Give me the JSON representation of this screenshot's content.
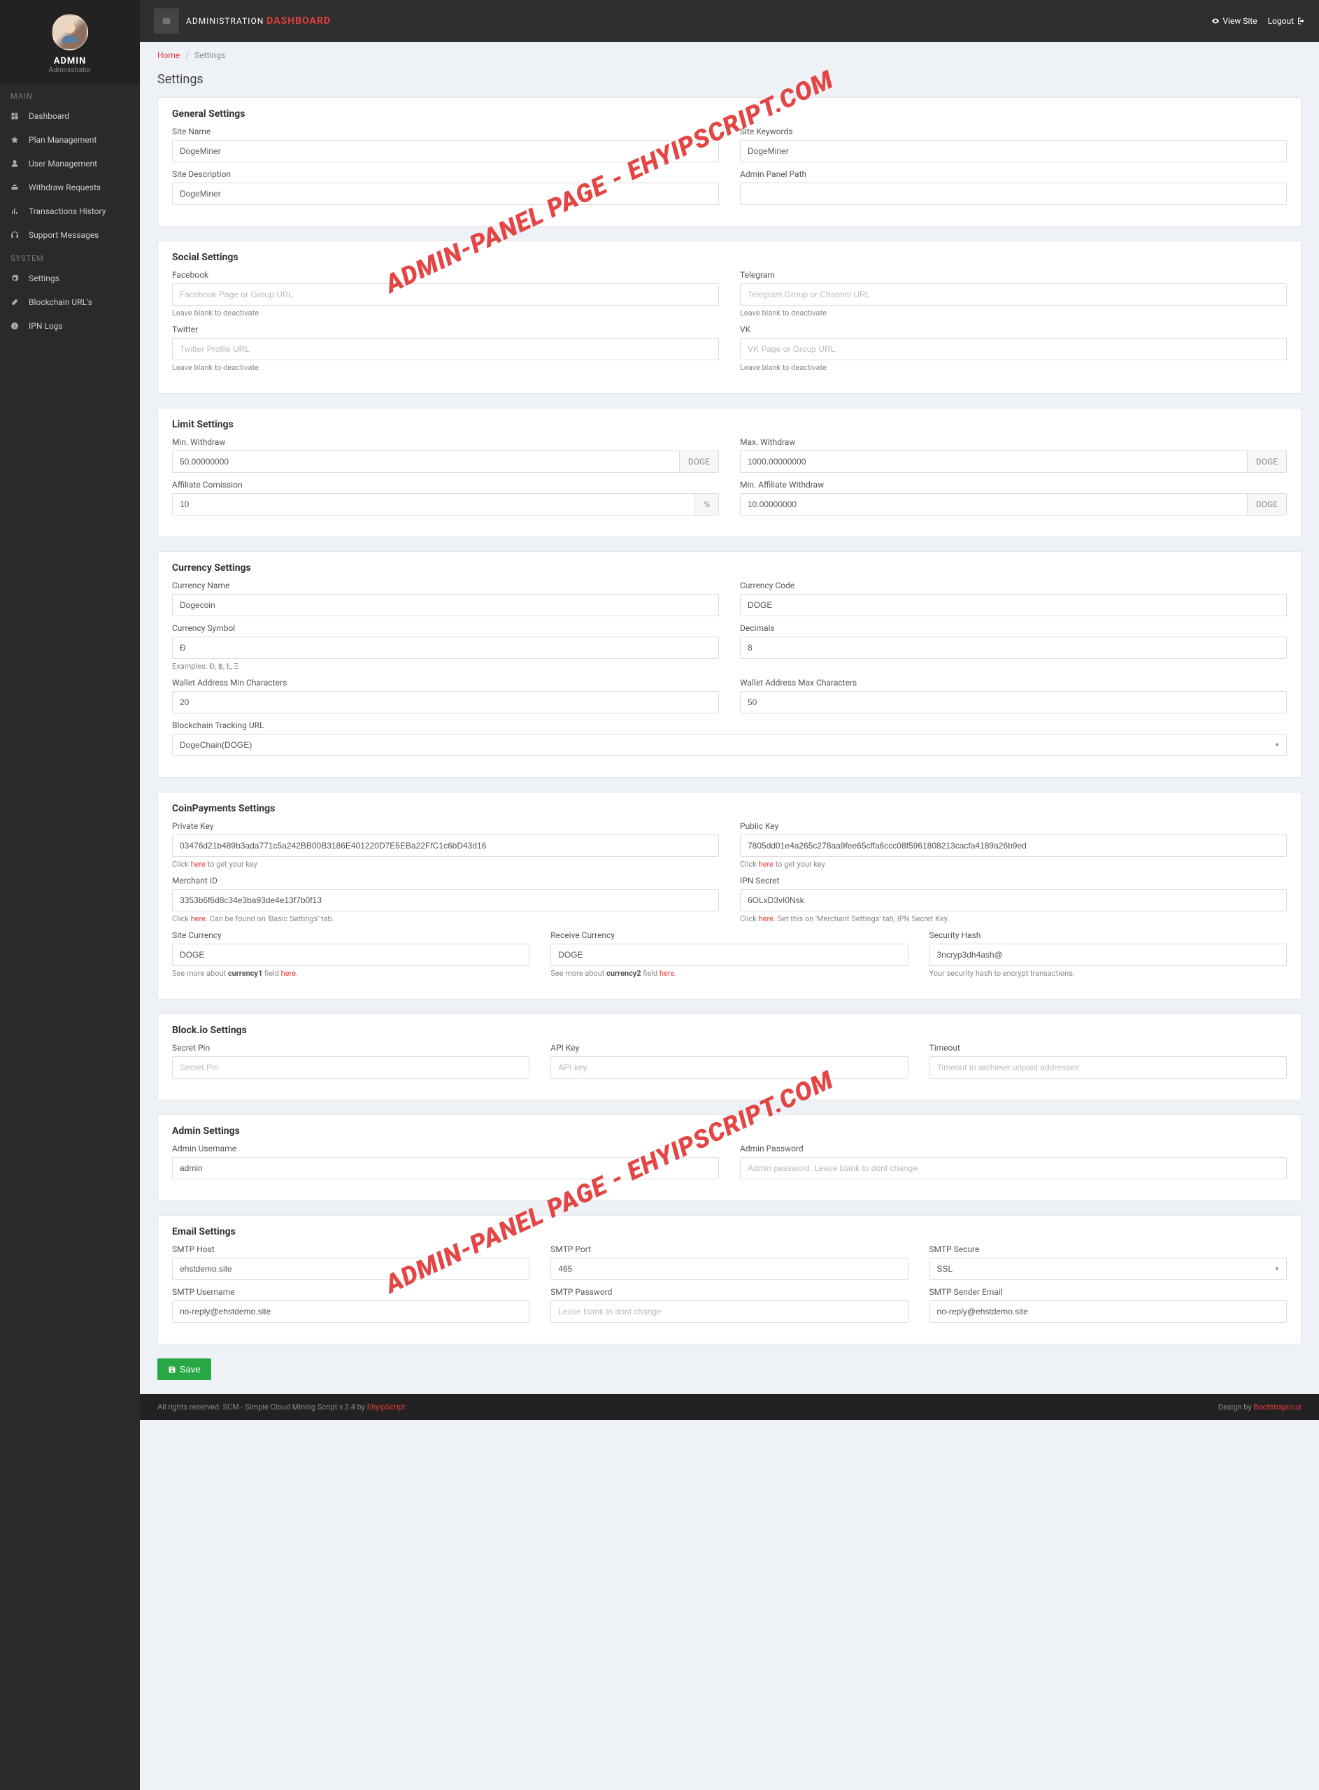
{
  "sidebar": {
    "profile_name": "ADMIN",
    "profile_role": "Administrator",
    "heading_main": "MAIN",
    "heading_system": "SYSTEM",
    "items_main": [
      {
        "label": "Dashboard",
        "icon": "dashboard"
      },
      {
        "label": "Plan Management",
        "icon": "plan"
      },
      {
        "label": "User Management",
        "icon": "user"
      },
      {
        "label": "Withdraw Requests",
        "icon": "withdraw"
      },
      {
        "label": "Transactions History",
        "icon": "chart"
      },
      {
        "label": "Support Messages",
        "icon": "support"
      }
    ],
    "items_system": [
      {
        "label": "Settings",
        "icon": "gear"
      },
      {
        "label": "Blockchain URL's",
        "icon": "link"
      },
      {
        "label": "IPN Logs",
        "icon": "info"
      }
    ]
  },
  "topbar": {
    "brand_prefix": "ADMINISTRATION",
    "brand_highlight": "DASHBOARD",
    "view_site": "View Site",
    "logout": "Logout"
  },
  "breadcrumb": {
    "home": "Home",
    "current": "Settings"
  },
  "page_title": "Settings",
  "watermark": "ADMIN-PANEL PAGE - EHYIPSCRIPT.COM",
  "sections": {
    "general": {
      "title": "General Settings",
      "site_name_label": "Site Name",
      "site_name_value": "DogeMiner",
      "site_keywords_label": "Site Keywords",
      "site_keywords_value": "DogeMiner",
      "site_desc_label": "Site Description",
      "site_desc_value": "DogeMiner",
      "admin_path_label": "Admin Panel Path",
      "admin_path_value": ""
    },
    "social": {
      "title": "Social Settings",
      "facebook_label": "Facebook",
      "facebook_placeholder": "Facebook Page or Group URL",
      "telegram_label": "Telegram",
      "telegram_placeholder": "Telegram Group or Channel URL",
      "twitter_label": "Twitter",
      "twitter_placeholder": "Twitter Profile URL",
      "vk_label": "VK",
      "vk_placeholder": "VK Page or Group URL",
      "help_blank": "Leave blank to deactivate"
    },
    "limit": {
      "title": "Limit Settings",
      "min_withdraw_label": "Min. Withdraw",
      "min_withdraw_value": "50.00000000",
      "max_withdraw_label": "Max. Withdraw",
      "max_withdraw_value": "1000.00000000",
      "affiliate_label": "Affiliate Comission",
      "affiliate_value": "10",
      "min_aff_withdraw_label": "Min. Affiliate Withdraw",
      "min_aff_withdraw_value": "10.00000000",
      "addon_doge": "DOGE",
      "addon_pct": "%"
    },
    "currency": {
      "title": "Currency Settings",
      "name_label": "Currency Name",
      "name_value": "Dogecoin",
      "code_label": "Currency Code",
      "code_value": "DOGE",
      "symbol_label": "Currency Symbol",
      "symbol_value": "Ɖ",
      "symbol_help": "Examples: Ɖ, ฿, Ł, Ξ",
      "decimals_label": "Decimals",
      "decimals_value": "8",
      "min_chars_label": "Wallet Address Min Characters",
      "min_chars_value": "20",
      "max_chars_label": "Wallet Address Max Characters",
      "max_chars_value": "50",
      "track_label": "Blockchain Tracking URL",
      "track_value": "DogeChain(DOGE)"
    },
    "coinpayments": {
      "title": "CoinPayments Settings",
      "private_label": "Private Key",
      "private_value": "03476d21b489b3ada771c5a242BB00B3186E401220D7E5EBa22FfC1c6bD43d16",
      "private_help_prefix": "Click ",
      "private_help_link": "here",
      "private_help_suffix": " to get your key",
      "public_label": "Public Key",
      "public_value": "7805dd01e4a265c278aa9fee65cffa6ccc08f5961808213cacfa4189a26b9ed",
      "public_help_prefix": "Click ",
      "public_help_link": "here",
      "public_help_suffix": " to get your key",
      "merchant_label": "Merchant ID",
      "merchant_value": "3353b6f6d8c34e3ba93de4e13f7b0f13",
      "merchant_help_prefix": "Click ",
      "merchant_help_link": "here",
      "merchant_help_suffix": ". Can be found on 'Basic Settings' tab.",
      "ipn_label": "IPN Secret",
      "ipn_value": "6OLxD3vI0Nsk",
      "ipn_help_prefix": "Click ",
      "ipn_help_link": "here",
      "ipn_help_suffix": ". Set this on 'Merchant Settings' tab, IPN Secret Key.",
      "site_cur_label": "Site Currency",
      "site_cur_value": "DOGE",
      "site_cur_help_prefix": "See more about ",
      "site_cur_help_bold": "currency1",
      "site_cur_help_mid": " field ",
      "site_cur_help_link": "here",
      "receive_cur_label": "Receive Currency",
      "receive_cur_value": "DOGE",
      "receive_cur_help_prefix": "See more about ",
      "receive_cur_help_bold": "currency2",
      "receive_cur_help_mid": " field ",
      "receive_cur_help_link": "here",
      "hash_label": "Security Hash",
      "hash_value": "3ncryp3dh4ash@",
      "hash_help": "Your security hash to encrypt transactions."
    },
    "blockio": {
      "title": "Block.io Settings",
      "secret_label": "Secret Pin",
      "secret_placeholder": "Secret Pin",
      "api_label": "API Key",
      "api_placeholder": "API key",
      "timeout_label": "Timeout",
      "timeout_placeholder": "Timeout to archieve unpaid addresses"
    },
    "admin": {
      "title": "Admin Settings",
      "user_label": "Admin Username",
      "user_value": "admin",
      "pass_label": "Admin Password",
      "pass_placeholder": "Admin password. Leave blank to dont change"
    },
    "email": {
      "title": "Email Settings",
      "host_label": "SMTP Host",
      "host_value": "ehstdemo.site",
      "port_label": "SMTP Port",
      "port_value": "465",
      "secure_label": "SMTP Secure",
      "secure_value": "SSL",
      "user_label": "SMTP Username",
      "user_value": "no-reply@ehstdemo.site",
      "pass_label": "SMTP Password",
      "pass_placeholder": "Leave blank to dont change",
      "sender_label": "SMTP Sender Email",
      "sender_value": "no-reply@ehstdemo.site"
    }
  },
  "save_button": "Save",
  "footer": {
    "left_prefix": "All rights reserved. SCM - Simple Cloud Mining Script v.2.4 by ",
    "left_link": "EhyipScript",
    "right_prefix": "Design by ",
    "right_link": "Bootstrapious"
  }
}
